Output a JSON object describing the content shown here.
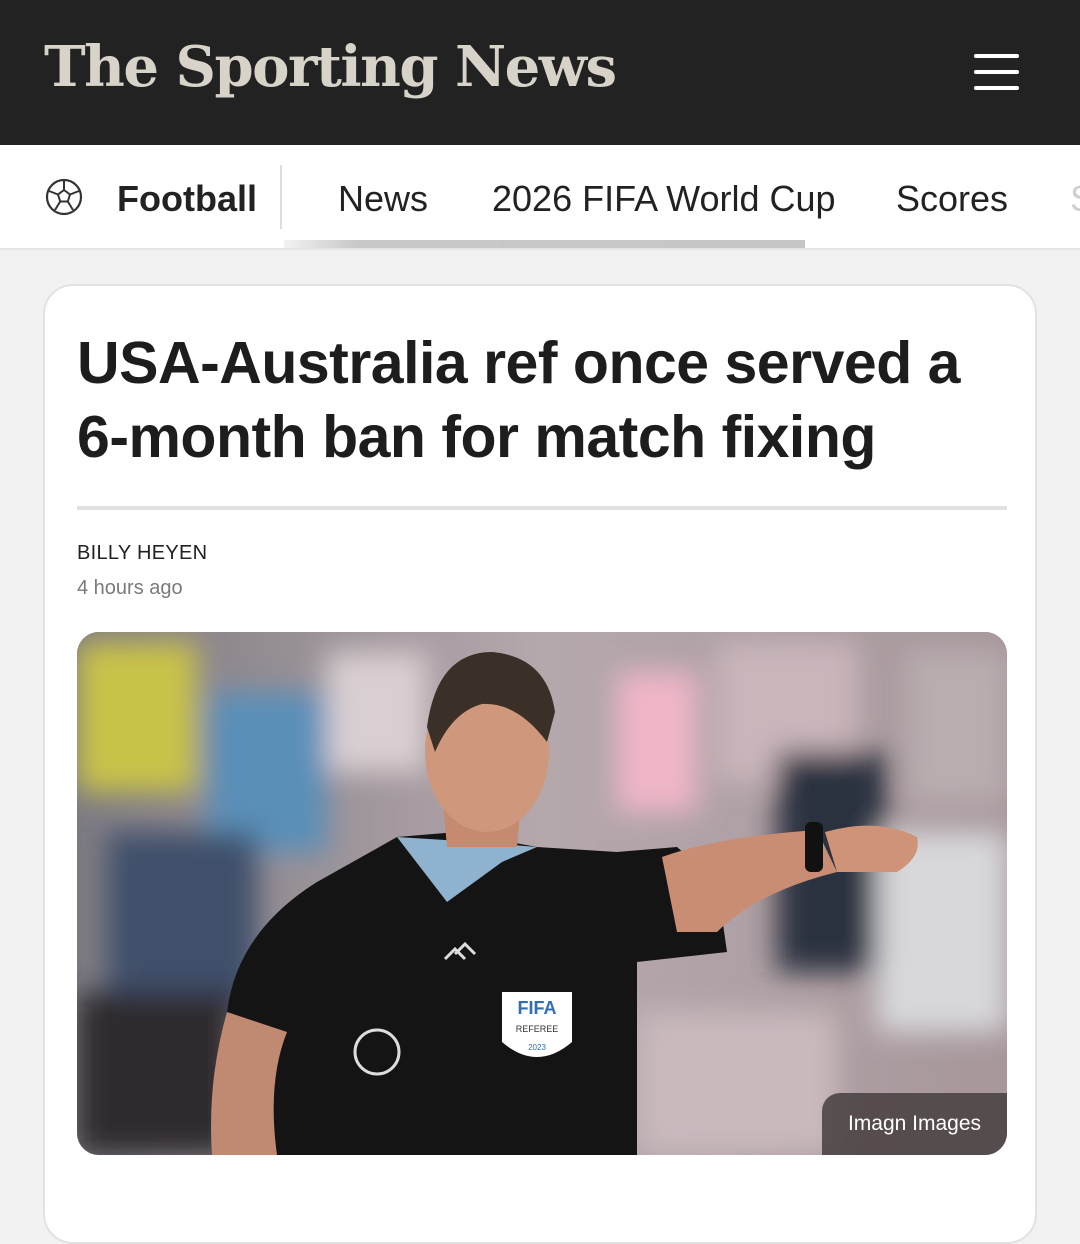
{
  "header": {
    "brand": "The Sporting News",
    "menu_icon": "hamburger-menu-icon"
  },
  "subnav": {
    "section_icon": "soccer-ball-icon",
    "section_title": "Football",
    "links": [
      {
        "label": "News"
      },
      {
        "label": "2026 FIFA World Cup"
      },
      {
        "label": "Scores"
      },
      {
        "label": "S"
      }
    ]
  },
  "article": {
    "headline": "USA-Australia ref once served a 6-month ban for match fixing",
    "author": "BILLY HEYEN",
    "timestamp": "4 hours ago",
    "image": {
      "credit": "Imagn Images",
      "badge_top": "FIFA",
      "badge_mid": "REFEREE",
      "badge_year": "2023"
    }
  },
  "colors": {
    "header_bg": "#222222",
    "brand_text": "#d7d3c9",
    "page_bg": "#f2f2f2",
    "card_bg": "#ffffff"
  }
}
